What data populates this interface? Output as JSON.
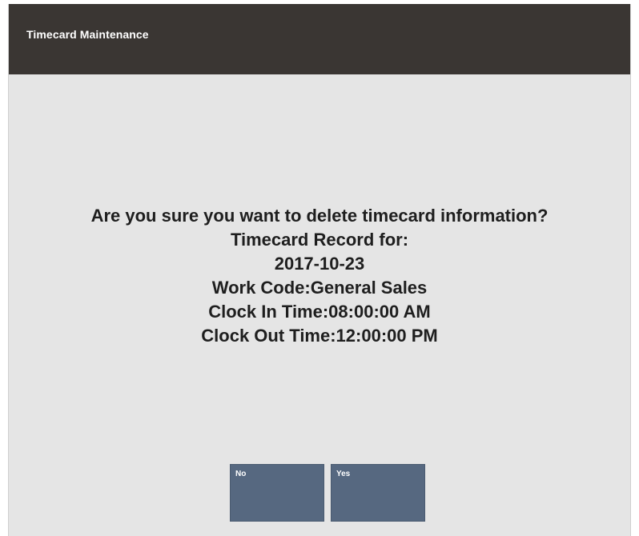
{
  "header": {
    "title": "Timecard Maintenance"
  },
  "dialog": {
    "question": "Are you sure you want to delete timecard information?",
    "lines": [
      "Timecard Record for:",
      "2017-10-23",
      "Work Code:General Sales",
      "Clock In Time:08:00:00 AM",
      "Clock Out Time:12:00:00 PM"
    ]
  },
  "buttons": {
    "no_label": "No",
    "yes_label": "Yes"
  },
  "colors": {
    "header_bg": "#3a3633",
    "content_bg": "#e5e5e5",
    "button_bg": "#566880"
  }
}
